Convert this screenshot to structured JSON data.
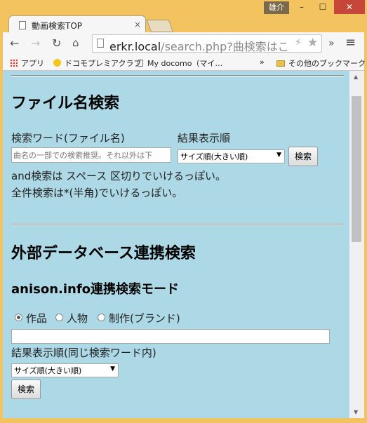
{
  "window": {
    "user_badge": "雄介",
    "minimize": "–",
    "maximize": "☐",
    "close": "✕"
  },
  "tabs": [
    {
      "title": "動画検索TOP",
      "close": "×"
    }
  ],
  "toolbar": {
    "url_host": "erkr.local",
    "url_rest": "/search.php?曲検索はこ",
    "overflow": "»",
    "menu": "≡"
  },
  "bookmarks": {
    "apps": "アプリ",
    "item1": "ドコモプレミアクラブ",
    "item2": "My docomo（マイ…",
    "more": "»",
    "other": "その他のブックマーク"
  },
  "filename_search": {
    "heading": "ファイル名検索",
    "keyword_label": "検索ワード(ファイル名)",
    "order_label": "結果表示順",
    "keyword_placeholder": "曲名の一部での検索推奨。それ以外は下",
    "order_selected": "サイズ順(大きい順)",
    "search_button": "検索",
    "note1": "and検索は スペース 区切りでいけるっぽい。",
    "note2": "全件検索は*(半角)でいけるっぽい。"
  },
  "external_search": {
    "heading": "外部データベース連携検索",
    "mode_heading": "anison.info連携検索モード",
    "radio_options": [
      "作品",
      "人物",
      "制作(ブランド)"
    ],
    "radio_selected": "作品",
    "keyword_value": "",
    "order_label": "結果表示順(同じ検索ワード内)",
    "order_selected": "サイズ順(大きい順)",
    "search_button": "検索"
  }
}
